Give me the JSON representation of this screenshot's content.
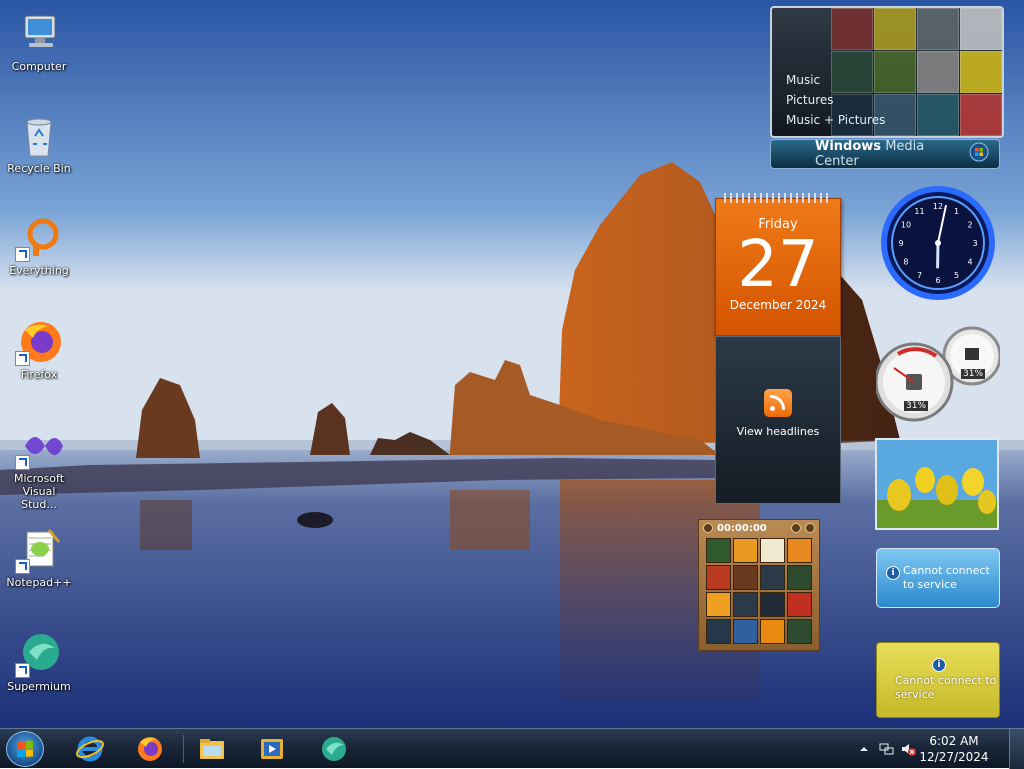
{
  "desktop": {
    "icons": [
      {
        "label": "Computer",
        "icon": "computer-icon"
      },
      {
        "label": "Recycle Bin",
        "icon": "recycle-bin-icon"
      },
      {
        "label": "Everything",
        "icon": "everything-search-icon"
      },
      {
        "label": "Firefox",
        "icon": "firefox-icon"
      },
      {
        "label": "Microsoft Visual Stud...",
        "icon": "visual-studio-icon"
      },
      {
        "label": "Notepad++",
        "icon": "notepad-plus-plus-icon"
      },
      {
        "label": "Supermium",
        "icon": "supermium-icon"
      }
    ]
  },
  "gadgets": {
    "media_center": {
      "menu": [
        "Music",
        "Pictures",
        "Music + Pictures"
      ],
      "brand_bold": "Windows",
      "brand_light": "Media Center"
    },
    "calendar": {
      "weekday": "Friday",
      "day": "27",
      "month_year": "December 2024"
    },
    "feed": {
      "label": "View headlines"
    },
    "cpu_meter": {
      "cpu_percent": "31%",
      "memory_percent": "31%"
    },
    "clock": {
      "hour": 6,
      "minute": 2
    },
    "weather": {
      "message": "Cannot connect to service"
    },
    "currency": {
      "message": "Cannot connect to service"
    },
    "puzzle": {
      "timer": "00:00:00"
    }
  },
  "taskbar": {
    "pinned": [
      {
        "name": "internet-explorer-icon"
      },
      {
        "name": "firefox-icon"
      },
      {
        "name": "file-explorer-icon"
      },
      {
        "name": "media-player-icon"
      },
      {
        "name": "supermium-icon"
      }
    ],
    "clock_time": "6:02 AM",
    "clock_date": "12/27/2024"
  },
  "colors": {
    "accent_orange": "#e8670f",
    "taskbar_dark": "#1a2638",
    "sky_top": "#2c5aa8"
  }
}
